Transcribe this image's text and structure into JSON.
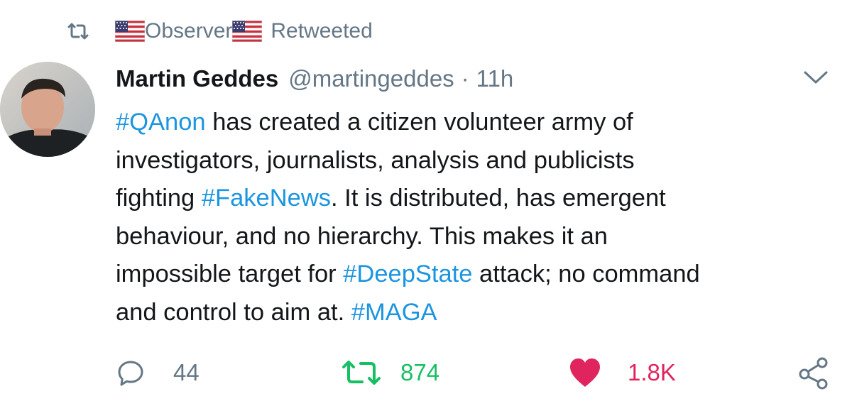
{
  "retweet_context": {
    "icon": "retweet-icon",
    "display_name": "Observer",
    "flag_icon": "us-flag-icon",
    "label": "Retweeted"
  },
  "tweet": {
    "author_name": "Martin Geddes",
    "handle": "@martingeddes",
    "separator": "·",
    "time": "11h",
    "menu_icon": "chevron-down-icon",
    "text_segments": {
      "l1_tag": "#QAnon",
      "l1_text": " has created a citizen volunteer army of",
      "l2_text": "investigators, journalists, analysis and publicists",
      "l3_text_a": "fighting ",
      "l3_tag": "#FakeNews",
      "l3_text_b": ". It is distributed, has emergent",
      "l4_text": "behaviour, and no hierarchy. This makes it an",
      "l5_text_a": "impossible target for ",
      "l5_tag": "#DeepState",
      "l5_text_b": " attack; no command",
      "l6_text": "and control to aim at. ",
      "l6_tag": "#MAGA"
    },
    "hashtag_color": "#1b95e0"
  },
  "actions": {
    "reply": {
      "icon": "reply-icon",
      "count": "44",
      "color": "#657786"
    },
    "retweet": {
      "icon": "retweet-icon",
      "count": "874",
      "color": "#17bf63",
      "active": true
    },
    "like": {
      "icon": "heart-icon",
      "count": "1.8K",
      "color": "#e0245e",
      "active": true
    },
    "share": {
      "icon": "share-icon"
    }
  }
}
